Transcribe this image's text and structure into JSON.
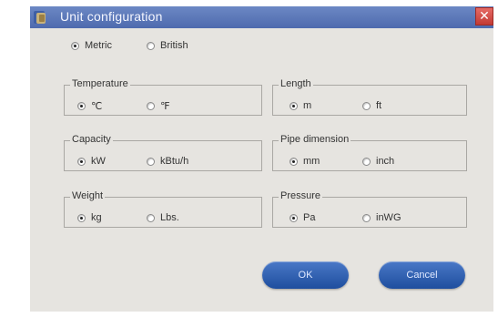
{
  "window": {
    "title": "Unit configuration"
  },
  "icons": {
    "app": "app-logo-icon",
    "close": "close-icon"
  },
  "colors": {
    "titlebar": "#5a76b8",
    "close": "#d24a44",
    "button": "#2f62b4",
    "panel": "#e6e4e0"
  },
  "system": {
    "options": [
      {
        "label": "Metric",
        "checked": true
      },
      {
        "label": "British",
        "checked": false
      }
    ]
  },
  "groups": {
    "temperature": {
      "label": "Temperature",
      "options": [
        {
          "label": "℃",
          "checked": true
        },
        {
          "label": "℉",
          "checked": false
        }
      ]
    },
    "length": {
      "label": "Length",
      "options": [
        {
          "label": "m",
          "checked": true
        },
        {
          "label": "ft",
          "checked": false
        }
      ]
    },
    "capacity": {
      "label": "Capacity",
      "options": [
        {
          "label": "kW",
          "checked": true
        },
        {
          "label": "kBtu/h",
          "checked": false
        }
      ]
    },
    "pipe": {
      "label": "Pipe dimension",
      "options": [
        {
          "label": "mm",
          "checked": true
        },
        {
          "label": "inch",
          "checked": false
        }
      ]
    },
    "weight": {
      "label": "Weight",
      "options": [
        {
          "label": "kg",
          "checked": true
        },
        {
          "label": "Lbs.",
          "checked": false
        }
      ]
    },
    "pressure": {
      "label": "Pressure",
      "options": [
        {
          "label": "Pa",
          "checked": true
        },
        {
          "label": "inWG",
          "checked": false
        }
      ]
    }
  },
  "buttons": {
    "ok": "OK",
    "cancel": "Cancel"
  }
}
